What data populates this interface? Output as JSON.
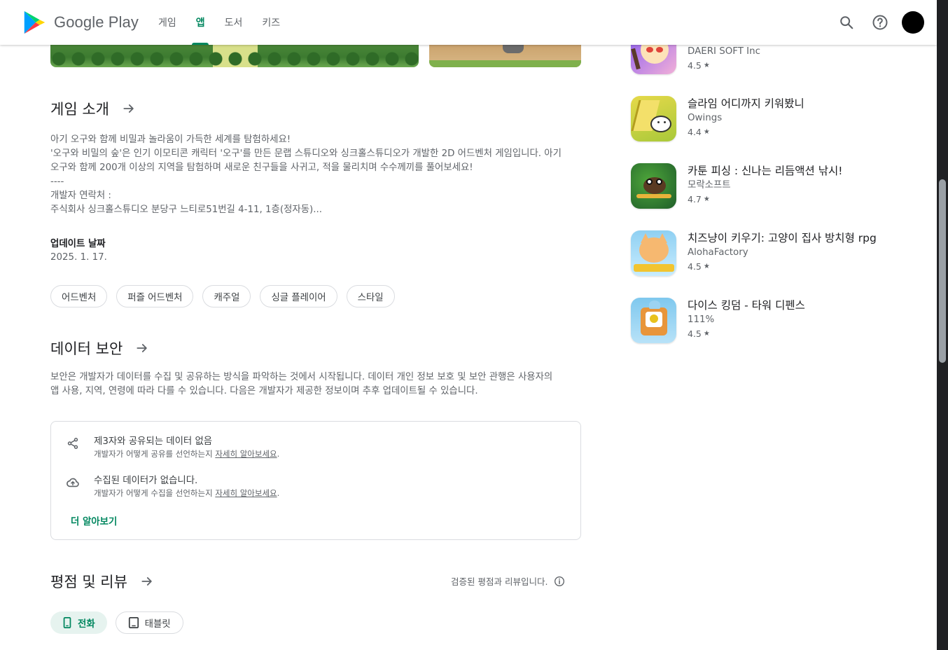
{
  "header": {
    "logo_text": "Google Play",
    "nav": [
      {
        "label": "게임"
      },
      {
        "label": "앱"
      },
      {
        "label": "도서"
      },
      {
        "label": "키즈"
      }
    ]
  },
  "about": {
    "title": "게임 소개",
    "lines": [
      "아기 오구와 함께 비밀과 놀라움이 가득한 세계를 탐험하세요!",
      "'오구와 비밀의 숲'은 인기 이모티콘 캐릭터 '오구'를 만든 문랩 스튜디오와 싱크홀스튜디오가 개발한 2D 어드벤처 게임입니다. 아기",
      "오구와 함께 200개 이상의 지역을 탐험하며 새로운 친구들을 사귀고, 적을 물리치며 수수께끼를 풀어보세요!",
      "----",
      "개발자 연락처 :",
      "주식회사 싱크홀스튜디오 분당구 느티로51번길 4-11, 1층(정자동)..."
    ],
    "updated_label": "업데이트 날짜",
    "updated_value": "2025. 1. 17.",
    "tags": [
      "어드벤처",
      "퍼즐 어드벤처",
      "캐주얼",
      "싱글 플레이어",
      "스타일"
    ]
  },
  "data_safety": {
    "title": "데이터 보안",
    "desc_lines": [
      "보안은 개발자가 데이터를 수집 및 공유하는 방식을 파악하는 것에서 시작됩니다. 데이터 개인 정보 보호 및 보안 관행은 사용자의",
      "앱 사용, 지역, 연령에 따라 다를 수 있습니다. 다음은 개발자가 제공한 정보이며 추후 업데이트될 수 있습니다."
    ],
    "items": [
      {
        "icon": "share-icon",
        "title": "제3자와 공유되는 데이터 없음",
        "sub": "개발자가 어떻게 공유를 선언하는지 ",
        "link": "자세히 알아보세요",
        "tail": "."
      },
      {
        "icon": "cloud-upload-icon",
        "title": "수집된 데이터가 없습니다.",
        "sub": "개발자가 어떻게 수집을 선언하는지 ",
        "link": "자세히 알아보세요",
        "tail": "."
      }
    ],
    "more_label": "더 알아보기"
  },
  "ratings": {
    "title": "평점 및 리뷰",
    "verified": "검증된 평점과 리뷰입니다.",
    "device_tabs": [
      {
        "label": "전화",
        "icon": "phone-icon"
      },
      {
        "label": "태블릿",
        "icon": "tablet-icon"
      }
    ]
  },
  "similar_apps": [
    {
      "name": "",
      "dev": "DAERI SOFT Inc",
      "rating": "4.5"
    },
    {
      "name": "슬라임 어디까지 키워봤니",
      "dev": "Owings",
      "rating": "4.4"
    },
    {
      "name": "카툰 피싱 : 신나는 리듬액션 낚시!",
      "dev": "모락소프트",
      "rating": "4.7"
    },
    {
      "name": "치즈냥이 키우기: 고양이 집사 방치형 rpg",
      "dev": "AlohaFactory",
      "rating": "4.5"
    },
    {
      "name": "다이스 킹덤 - 타워 디펜스",
      "dev": "111%",
      "rating": "4.5"
    }
  ],
  "colors": {
    "accent": "#01875f",
    "text_primary": "#202124",
    "text_secondary": "#5f6368"
  }
}
